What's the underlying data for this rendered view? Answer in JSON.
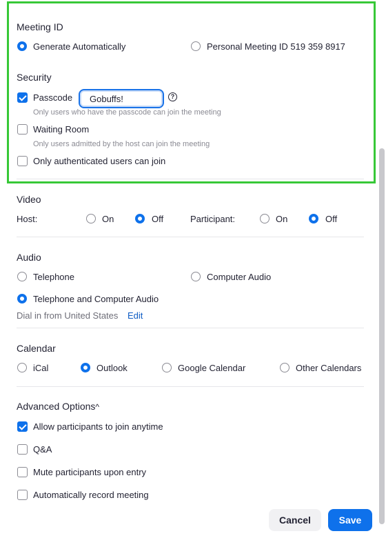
{
  "meeting_id": {
    "heading": "Meeting ID",
    "options": [
      {
        "label": "Generate Automatically",
        "selected": true
      },
      {
        "label": "Personal Meeting ID 519 359 8917",
        "selected": false
      }
    ]
  },
  "security": {
    "heading": "Security",
    "passcode": {
      "label": "Passcode",
      "checked": true,
      "value": "Gobuffs!",
      "hint": "Only users who have the passcode can join the meeting"
    },
    "help_icon": "?",
    "waiting_room": {
      "label": "Waiting Room",
      "checked": false,
      "hint": "Only users admitted by the host can join the meeting"
    },
    "authenticated": {
      "label": "Only authenticated users can join",
      "checked": false
    }
  },
  "video": {
    "heading": "Video",
    "host_label": "Host:",
    "participant_label": "Participant:",
    "on": "On",
    "off": "Off",
    "host_value": "Off",
    "participant_value": "Off"
  },
  "audio": {
    "heading": "Audio",
    "options": [
      {
        "label": "Telephone",
        "selected": false
      },
      {
        "label": "Computer Audio",
        "selected": false
      },
      {
        "label": "Telephone and Computer Audio",
        "selected": true
      }
    ],
    "dial_in": "Dial in from United States",
    "edit": "Edit"
  },
  "calendar": {
    "heading": "Calendar",
    "options": [
      {
        "label": "iCal",
        "selected": false
      },
      {
        "label": "Outlook",
        "selected": true
      },
      {
        "label": "Google Calendar",
        "selected": false
      },
      {
        "label": "Other Calendars",
        "selected": false
      }
    ]
  },
  "advanced": {
    "heading": "Advanced Options",
    "caret": "^",
    "options": [
      {
        "label": "Allow participants to join anytime",
        "checked": true
      },
      {
        "label": "Q&A",
        "checked": false
      },
      {
        "label": "Mute participants upon entry",
        "checked": false
      },
      {
        "label": "Automatically record meeting",
        "checked": false
      }
    ]
  },
  "footer": {
    "cancel": "Cancel",
    "save": "Save"
  },
  "colors": {
    "accent": "#0e71eb",
    "highlight": "#37c837"
  }
}
